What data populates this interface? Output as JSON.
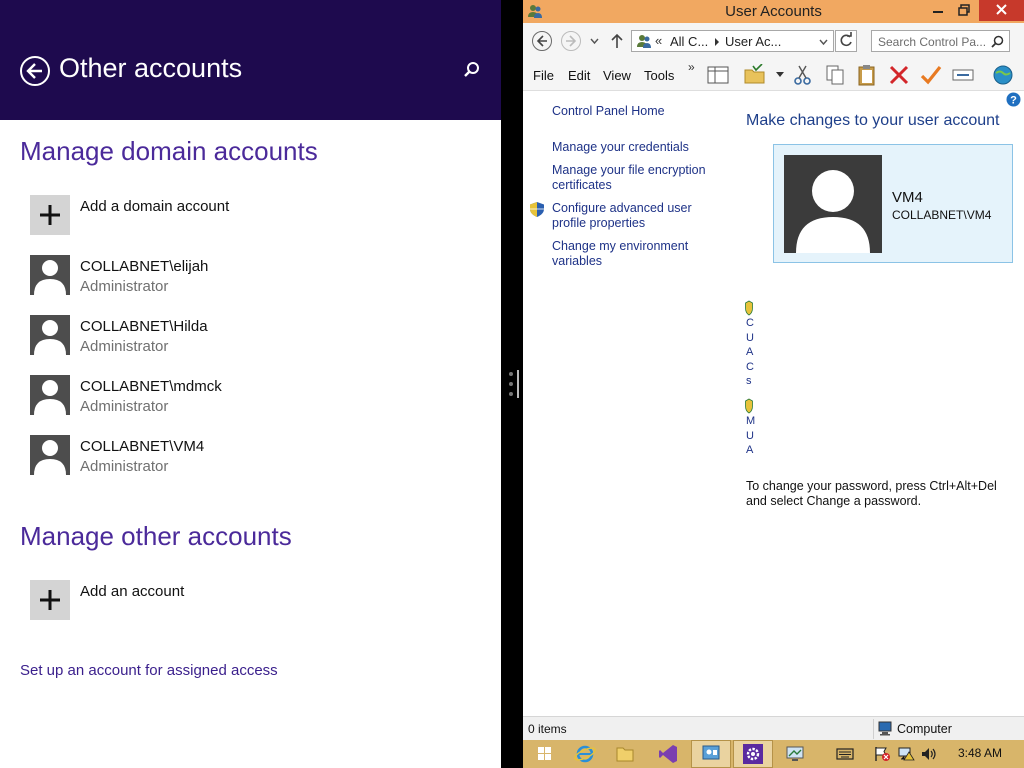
{
  "settings": {
    "title": "Other accounts",
    "domain_section": "Manage domain accounts",
    "add_domain": "Add a domain account",
    "accounts": [
      {
        "name": "COLLABNET\\elijah",
        "role": "Administrator"
      },
      {
        "name": "COLLABNET\\Hilda",
        "role": "Administrator"
      },
      {
        "name": "COLLABNET\\mdmck",
        "role": "Administrator"
      },
      {
        "name": "COLLABNET\\VM4",
        "role": "Administrator"
      }
    ],
    "other_section": "Manage other accounts",
    "add_account": "Add an account",
    "assigned_access": "Set up an account for assigned access"
  },
  "window": {
    "title": "User Accounts",
    "address": {
      "part1": "All C...",
      "part2": "User Ac..."
    },
    "search_placeholder": "Search Control Pa...",
    "menu": [
      "File",
      "Edit",
      "View",
      "Tools"
    ],
    "nav": {
      "home": "Control Panel Home",
      "links": [
        "Manage your credentials",
        "Manage your file encryption certificates",
        "Configure advanced user profile properties",
        "Change my environment variables"
      ]
    },
    "heading": "Make changes to your user account",
    "user": {
      "name": "VM4",
      "domain": "COLLABNET\\VM4"
    },
    "truncated_1": [
      "C",
      "U",
      "A",
      "C",
      "s"
    ],
    "truncated_2": [
      "M",
      "U",
      "A"
    ],
    "password_note": "To change your password, press Ctrl+Alt+Del and select Change a password.",
    "status": {
      "items": "0 items",
      "location": "Computer"
    }
  },
  "taskbar": {
    "time": "3:48 AM"
  },
  "colors": {
    "header": "#1e0a4e",
    "accent": "#4b2a9a",
    "titlebar": "#f1a861",
    "taskbar": "#d8b56a",
    "link": "#1e3287"
  }
}
